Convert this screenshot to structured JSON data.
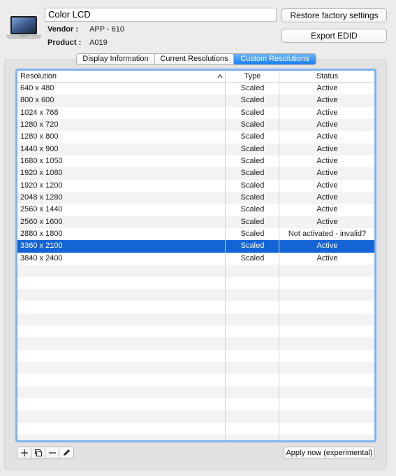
{
  "header": {
    "display_name": "Color LCD",
    "vendor_label": "Vendor :",
    "vendor_value": "APP - 610",
    "product_label": "Product :",
    "product_value": "A019",
    "restore_label": "Restore factory settings",
    "export_label": "Export EDID",
    "display_icon": "laptop-icon"
  },
  "tabs": [
    {
      "label": "Display Information",
      "active": false
    },
    {
      "label": "Current Resolutions",
      "active": false
    },
    {
      "label": "Custom Resolutions",
      "active": true
    }
  ],
  "table": {
    "columns": [
      "Resolution",
      "Type",
      "Status"
    ],
    "sort_indicator": "^",
    "rows": [
      {
        "resolution": "640 x 480",
        "type": "Scaled",
        "status": "Active"
      },
      {
        "resolution": "800 x 600",
        "type": "Scaled",
        "status": "Active"
      },
      {
        "resolution": "1024 x 768",
        "type": "Scaled",
        "status": "Active"
      },
      {
        "resolution": "1280 x 720",
        "type": "Scaled",
        "status": "Active"
      },
      {
        "resolution": "1280 x 800",
        "type": "Scaled",
        "status": "Active"
      },
      {
        "resolution": "1440 x 900",
        "type": "Scaled",
        "status": "Active"
      },
      {
        "resolution": "1680 x 1050",
        "type": "Scaled",
        "status": "Active"
      },
      {
        "resolution": "1920 x 1080",
        "type": "Scaled",
        "status": "Active"
      },
      {
        "resolution": "1920 x 1200",
        "type": "Scaled",
        "status": "Active"
      },
      {
        "resolution": "2048 x 1280",
        "type": "Scaled",
        "status": "Active"
      },
      {
        "resolution": "2560 x 1440",
        "type": "Scaled",
        "status": "Active"
      },
      {
        "resolution": "2560 x 1600",
        "type": "Scaled",
        "status": "Active"
      },
      {
        "resolution": "2880 x 1800",
        "type": "Scaled",
        "status": "Not activated - invalid?"
      },
      {
        "resolution": "3360 x 2100",
        "type": "Scaled",
        "status": "Active",
        "selected": true
      },
      {
        "resolution": "3840 x 2400",
        "type": "Scaled",
        "status": "Active"
      }
    ],
    "empty_rows": 15
  },
  "toolbar": {
    "tools": [
      {
        "name": "add-icon",
        "glyph": "+"
      },
      {
        "name": "duplicate-icon",
        "glyph": ""
      },
      {
        "name": "remove-icon",
        "glyph": "—"
      },
      {
        "name": "edit-pencil-icon",
        "glyph": ""
      }
    ],
    "apply_label": "Apply now (experimental)"
  },
  "colors": {
    "accent": "#1b7ff0",
    "selection": "#1464d6",
    "focus_ring": "#7fb2ef",
    "window_bg": "#ececec"
  }
}
